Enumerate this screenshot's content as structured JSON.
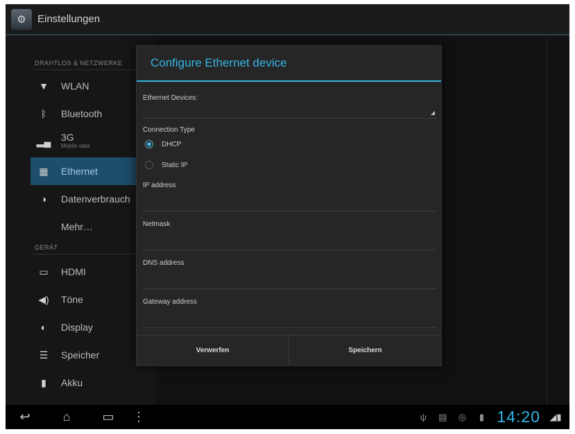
{
  "app": {
    "title": "Einstellungen",
    "icon": "settings-icon"
  },
  "sidebar": {
    "cat_wireless": "DRAHTLOS & NETZWERKE",
    "cat_device": "GERÄT",
    "items": [
      {
        "label": "WLAN",
        "icon": "wifi-icon"
      },
      {
        "label": "Bluetooth",
        "icon": "bluetooth-icon"
      },
      {
        "label": "3G",
        "sub": "Mobile data",
        "icon": "signal-icon"
      },
      {
        "label": "Ethernet",
        "icon": "ethernet-icon",
        "selected": true
      },
      {
        "label": "Datenverbrauch",
        "icon": "data-usage-icon"
      },
      {
        "label": "Mehr…",
        "icon": ""
      },
      {
        "label": "HDMI",
        "icon": "hdmi-icon"
      },
      {
        "label": "Töne",
        "icon": "sound-icon"
      },
      {
        "label": "Display",
        "icon": "display-icon"
      },
      {
        "label": "Speicher",
        "icon": "storage-icon"
      },
      {
        "label": "Akku",
        "icon": "battery-icon"
      }
    ]
  },
  "dialog": {
    "title": "Configure Ethernet device",
    "devices_label": "Ethernet Devices:",
    "devices_value": "",
    "connection_type_label": "Connection Type",
    "dhcp_label": "DHCP",
    "static_label": "Static IP",
    "selected_connection": "DHCP",
    "ip_label": "IP address",
    "ip_value": "",
    "netmask_label": "Netmask",
    "netmask_value": "",
    "dns_label": "DNS address",
    "dns_value": "",
    "gateway_label": "Gateway address",
    "gateway_value": "",
    "discard_label": "Verwerfen",
    "save_label": "Speichern"
  },
  "systembar": {
    "clock": "14:20",
    "accent": "#33b5e5"
  }
}
